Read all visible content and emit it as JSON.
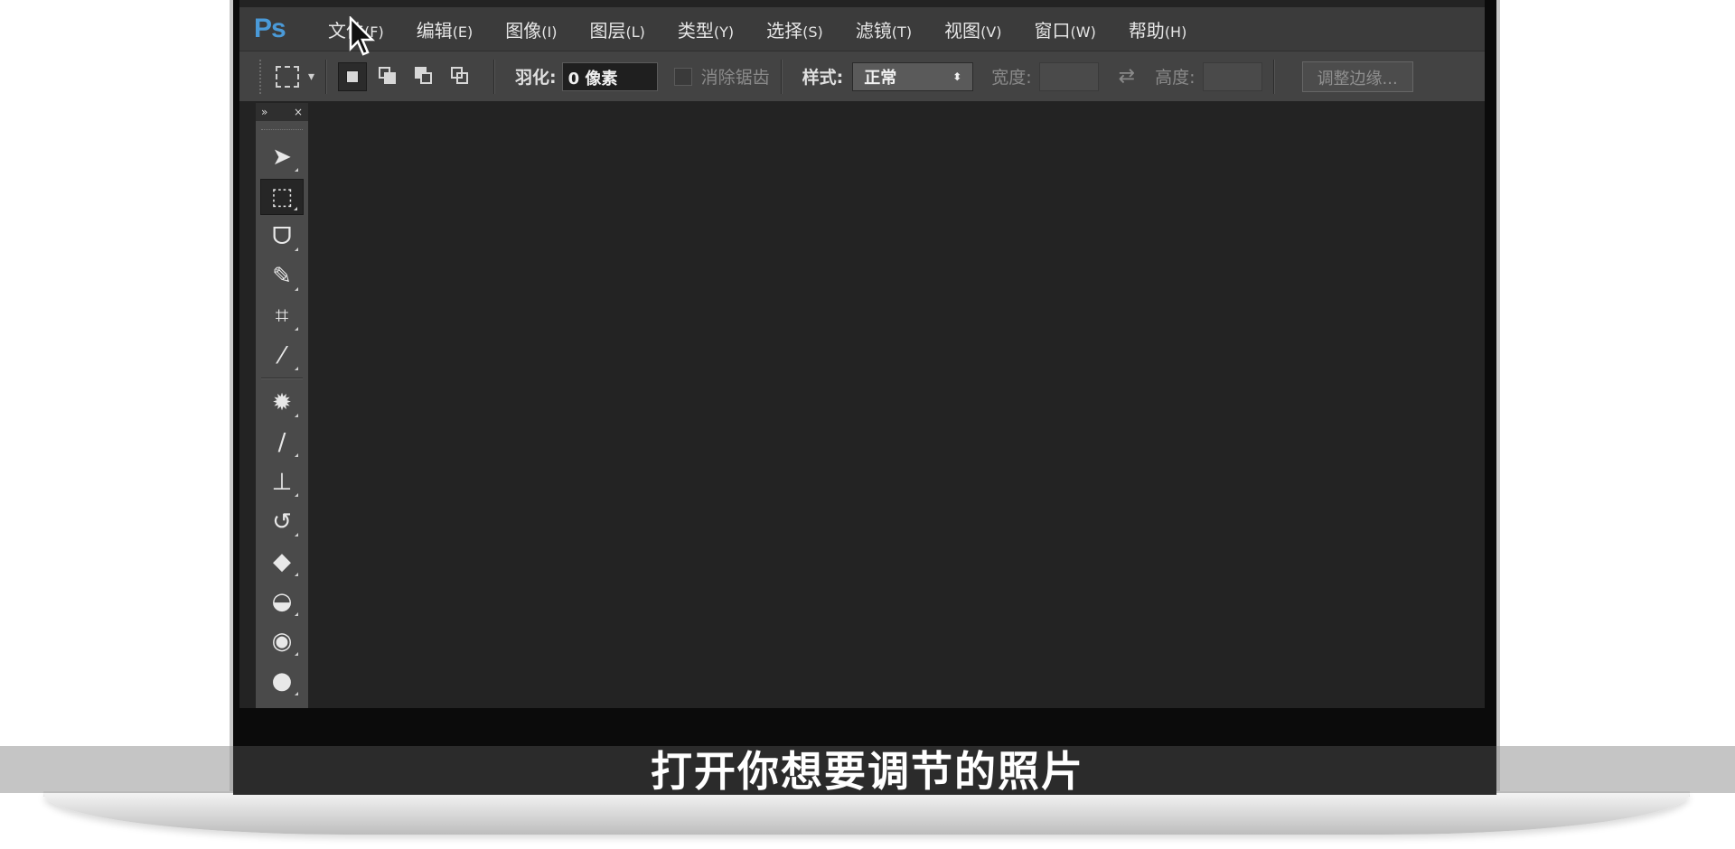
{
  "app": {
    "logo": "Ps",
    "menu": [
      {
        "label": "文件",
        "key": "(F)"
      },
      {
        "label": "编辑",
        "key": "(E)"
      },
      {
        "label": "图像",
        "key": "(I)"
      },
      {
        "label": "图层",
        "key": "(L)"
      },
      {
        "label": "类型",
        "key": "(Y)"
      },
      {
        "label": "选择",
        "key": "(S)"
      },
      {
        "label": "滤镜",
        "key": "(T)"
      },
      {
        "label": "视图",
        "key": "(V)"
      },
      {
        "label": "窗口",
        "key": "(W)"
      },
      {
        "label": "帮助",
        "key": "(H)"
      }
    ]
  },
  "options": {
    "feather_label": "羽化:",
    "feather_value": "0 像素",
    "antialias_label": "消除锯齿",
    "style_label": "样式:",
    "style_value": "正常",
    "width_label": "宽度:",
    "height_label": "高度:",
    "refine_edge_button": "调整边缘..."
  },
  "toolbox": {
    "collapse_glyph": "»",
    "close_glyph": "×",
    "tools": [
      {
        "name": "move-tool",
        "glyph": "➤",
        "icon": "move-icon"
      },
      {
        "name": "marquee-tool",
        "glyph": "⬚",
        "icon": "rect-marquee-icon"
      },
      {
        "name": "lasso-tool",
        "glyph": "ᗜ",
        "icon": "polygonal-lasso-icon"
      },
      {
        "name": "quick-select-tool",
        "glyph": "✎",
        "icon": "quick-selection-icon"
      },
      {
        "name": "crop-tool",
        "glyph": "⌗",
        "icon": "crop-icon"
      },
      {
        "name": "eyedropper-tool",
        "glyph": "⁄",
        "icon": "eyedropper-icon"
      },
      {
        "name": "healing-tool",
        "glyph": "✹",
        "icon": "spot-healing-icon"
      },
      {
        "name": "brush-tool",
        "glyph": "∕",
        "icon": "brush-icon"
      },
      {
        "name": "stamp-tool",
        "glyph": "⊥",
        "icon": "clone-stamp-icon"
      },
      {
        "name": "history-brush-tool",
        "glyph": "↺",
        "icon": "history-brush-icon"
      },
      {
        "name": "eraser-tool",
        "glyph": "◆",
        "icon": "eraser-icon"
      },
      {
        "name": "paint-bucket-tool",
        "glyph": "◒",
        "icon": "paint-bucket-icon"
      },
      {
        "name": "blur-tool",
        "glyph": "◉",
        "icon": "blur-icon"
      },
      {
        "name": "dodge-tool",
        "glyph": "●",
        "icon": "dodge-icon"
      }
    ]
  },
  "subtitle": "打开你想要调节的照片",
  "colors": {
    "ps_blue": "#4a9ad8",
    "workspace": "#232323",
    "menubar": "#3b3b3b"
  }
}
